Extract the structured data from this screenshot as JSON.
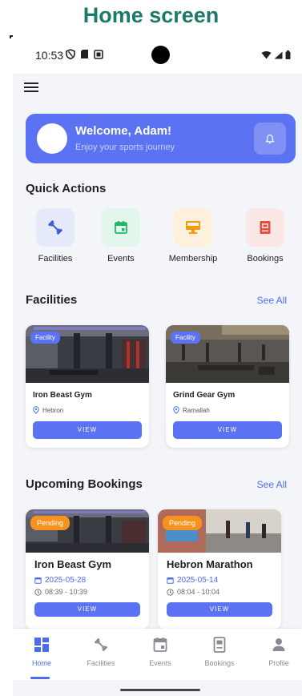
{
  "caption": "Home screen",
  "status_bar": {
    "time": "10:53"
  },
  "welcome": {
    "title": "Welcome, Adam!",
    "subtitle": "Enjoy your sports journey"
  },
  "quick_actions": {
    "title": "Quick Actions",
    "items": [
      {
        "label": "Facilities",
        "icon": "dumbbell-icon",
        "color": "#3b5bdb",
        "bg": "#e6ebfb"
      },
      {
        "label": "Events",
        "icon": "calendar-icon",
        "color": "#1fb86b",
        "bg": "#e3f6ec"
      },
      {
        "label": "Membership",
        "icon": "card-icon",
        "color": "#f39c12",
        "bg": "#fdf1de"
      },
      {
        "label": "Bookings",
        "icon": "booking-icon",
        "color": "#e74c3c",
        "bg": "#fbe7e5"
      }
    ]
  },
  "facilities": {
    "title": "Facilities",
    "see_all": "See All",
    "cards": [
      {
        "badge": "Facility",
        "name": "Iron Beast Gym",
        "location": "Hebron",
        "button": "VIEW"
      },
      {
        "badge": "Facility",
        "name": "Grind Gear Gym",
        "location": "Ramallah",
        "button": "VIEW"
      }
    ]
  },
  "bookings": {
    "title": "Upcoming Bookings",
    "see_all": "See All",
    "cards": [
      {
        "badge": "Pending",
        "name": "Iron Beast Gym",
        "date": "2025-05-28",
        "time": "08:39 - 10:39",
        "button": "VIEW"
      },
      {
        "badge": "Pending",
        "name": "Hebron Marathon",
        "date": "2025-05-14",
        "time": "08:04 - 10:04",
        "button": "VIEW"
      }
    ]
  },
  "bottom_nav": {
    "items": [
      {
        "label": "Home",
        "icon": "home-grid-icon",
        "active": true
      },
      {
        "label": "Facilities",
        "icon": "dumbbell-icon",
        "active": false
      },
      {
        "label": "Events",
        "icon": "calendar-icon",
        "active": false
      },
      {
        "label": "Bookings",
        "icon": "booking-icon",
        "active": false
      },
      {
        "label": "Profile",
        "icon": "person-icon",
        "active": false
      }
    ]
  },
  "colors": {
    "accent": "#5b72f2",
    "pending": "#f7921e",
    "caption": "#1c7a6b"
  }
}
